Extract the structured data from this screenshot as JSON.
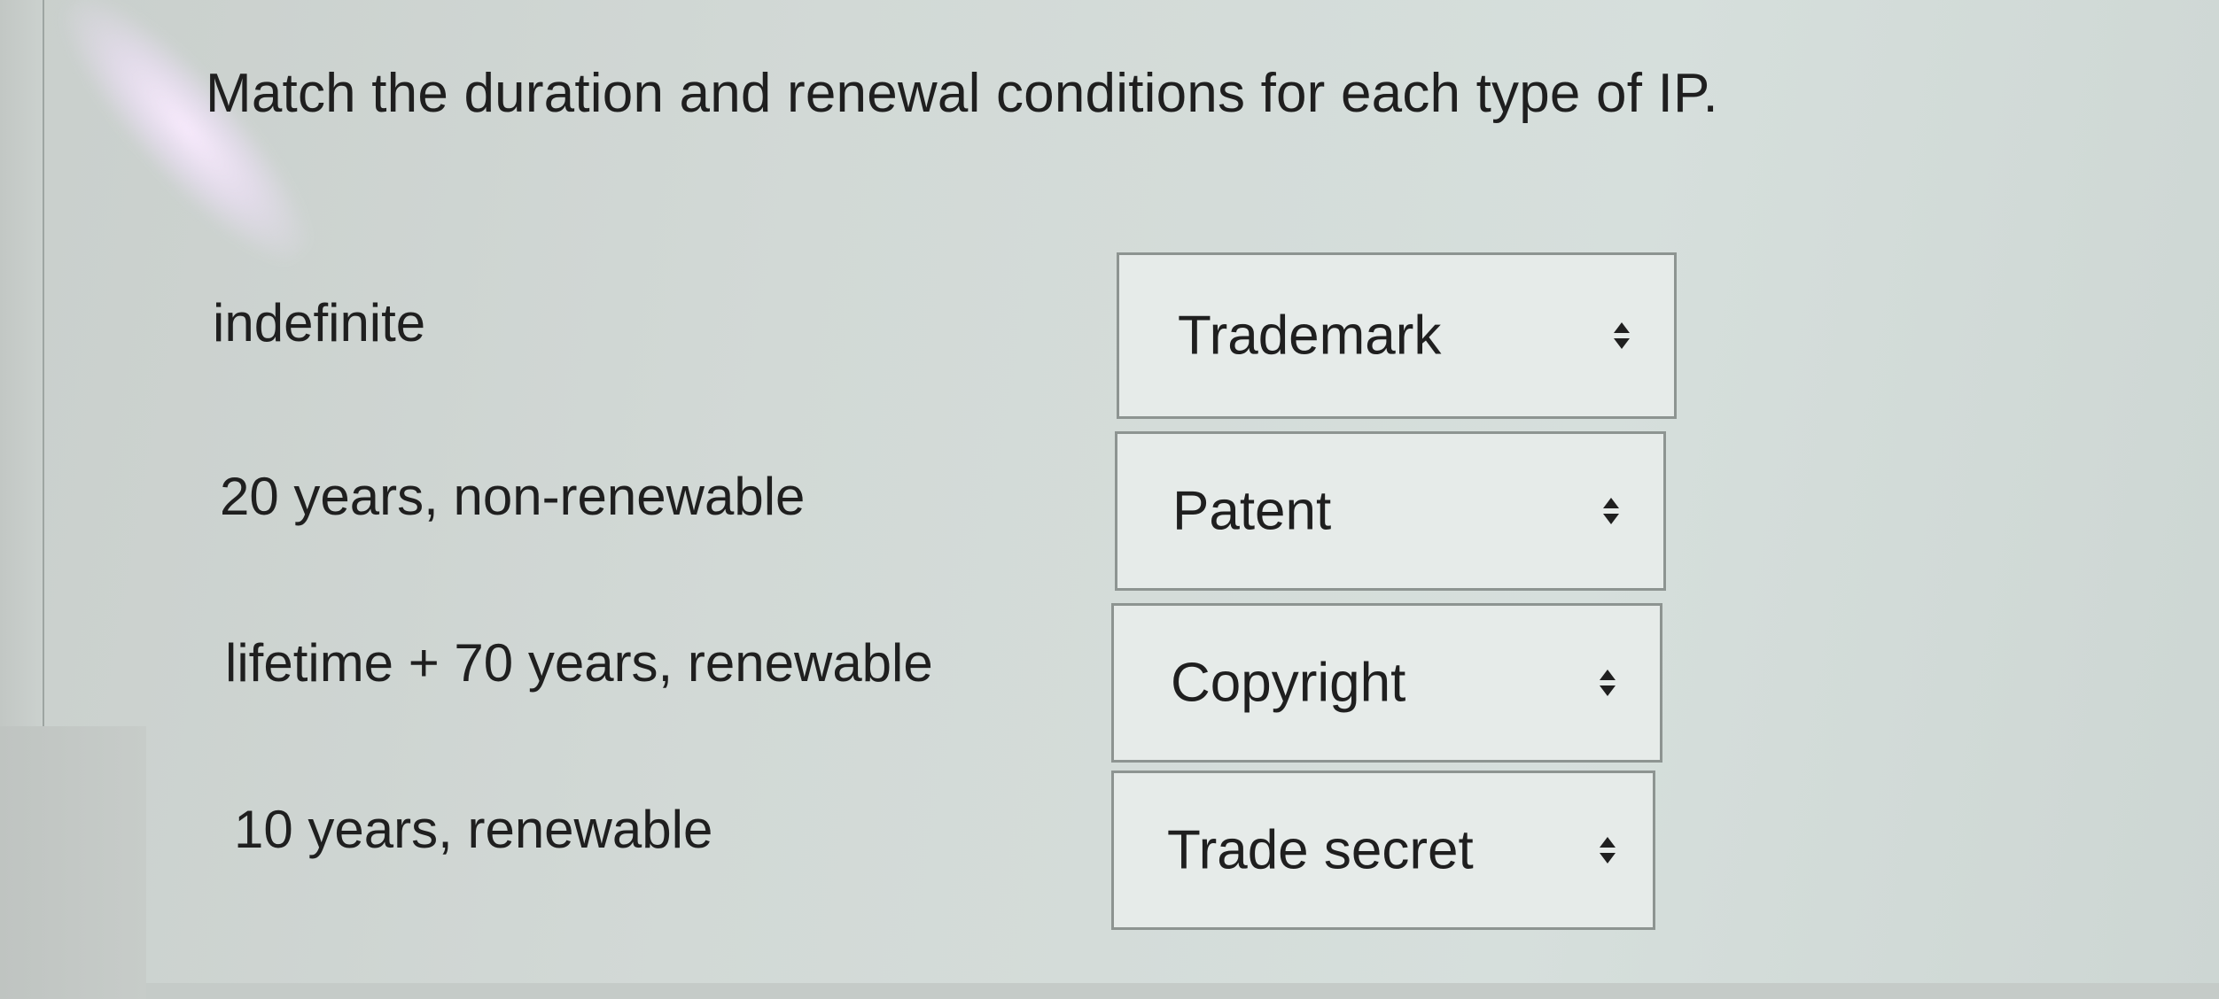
{
  "question": {
    "text": "Match the duration and renewal conditions for each type of IP."
  },
  "rows": [
    {
      "label": "indefinite",
      "selected": "Trademark"
    },
    {
      "label": "20 years, non-renewable",
      "selected": "Patent"
    },
    {
      "label": "lifetime + 70 years, renewable",
      "selected": "Copyright"
    },
    {
      "label": "10 years, renewable",
      "selected": "Trade secret"
    }
  ],
  "icons": {
    "dropdown_arrow": "updown-chevron-icon"
  }
}
